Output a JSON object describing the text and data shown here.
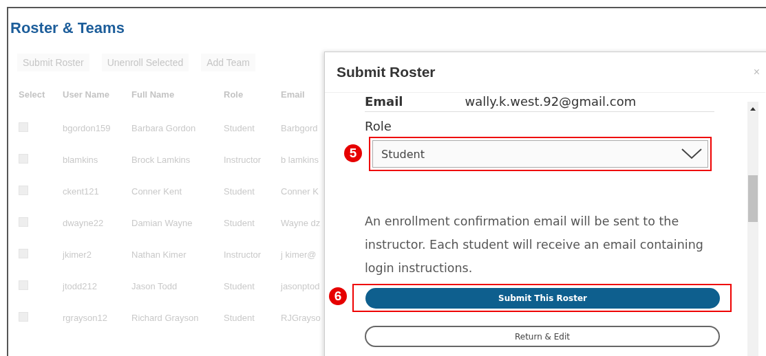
{
  "page": {
    "title": "Roster & Teams"
  },
  "toolbar": [
    "Submit Roster",
    "Unenroll Selected",
    "Add Team"
  ],
  "table": {
    "columns": [
      "Select",
      "User Name",
      "Full Name",
      "Role",
      "Email"
    ],
    "rows": [
      {
        "checked": false,
        "user_name": "bgordon159",
        "full_name": "Barbara Gordon",
        "role": "Student",
        "email": "Barbgord"
      },
      {
        "checked": false,
        "user_name": "blamkins",
        "full_name": "Brock Lamkins",
        "role": "Instructor",
        "email": "b lamkins"
      },
      {
        "checked": false,
        "user_name": "ckent121",
        "full_name": "Conner Kent",
        "role": "Student",
        "email": "Conner K"
      },
      {
        "checked": false,
        "user_name": "dwayne22",
        "full_name": "Damian Wayne",
        "role": "Student",
        "email": "Wayne dz"
      },
      {
        "checked": false,
        "user_name": "jkimer2",
        "full_name": "Nathan Kimer",
        "role": "Instructor",
        "email": "j kimer@"
      },
      {
        "checked": false,
        "user_name": "jtodd212",
        "full_name": "Jason Todd",
        "role": "Student",
        "email": "jasonptod"
      },
      {
        "checked": false,
        "user_name": "rgrayson12",
        "full_name": "Richard Grayson",
        "role": "Student",
        "email": "RJGrayso"
      }
    ]
  },
  "modal": {
    "title": "Submit Roster",
    "close": "×",
    "email_label": "Email",
    "email_value": "wally.k.west.92@gmail.com",
    "role_label": "Role",
    "role_value": "Student",
    "message": "An enrollment confirmation email will be sent to the instructor. Each student will receive an email containing login instructions.",
    "primary_button": "Submit This Roster",
    "secondary_button": "Return & Edit"
  },
  "annotations": [
    {
      "number": "5"
    },
    {
      "number": "6"
    }
  ]
}
